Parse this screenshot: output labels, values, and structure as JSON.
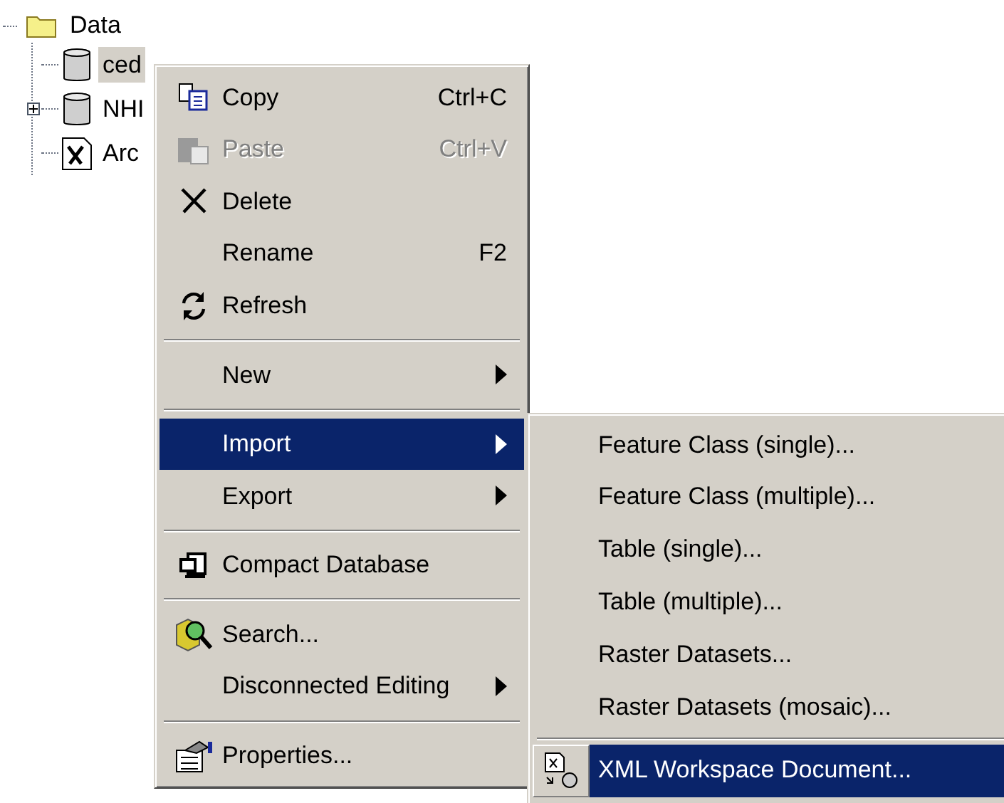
{
  "tree": {
    "label": "Data",
    "children": [
      {
        "label": "ced",
        "kind": "database",
        "collapsed": false,
        "selected": true
      },
      {
        "label": "NHI",
        "kind": "database",
        "collapsed": true,
        "selected": false
      },
      {
        "label": "Arc",
        "kind": "xml",
        "collapsed": false,
        "selected": false
      }
    ]
  },
  "context_menu": {
    "items": [
      {
        "kind": "item",
        "label": "Copy",
        "shortcut": "Ctrl+C",
        "disabled": false,
        "selected": false,
        "submenu": false
      },
      {
        "kind": "item",
        "label": "Paste",
        "shortcut": "Ctrl+V",
        "disabled": true,
        "selected": false,
        "submenu": false
      },
      {
        "kind": "item",
        "label": "Delete",
        "disabled": false,
        "selected": false,
        "submenu": false
      },
      {
        "kind": "item",
        "label": "Rename",
        "shortcut": "F2",
        "disabled": false,
        "selected": false,
        "submenu": false
      },
      {
        "kind": "item",
        "label": "Refresh",
        "disabled": false,
        "selected": false,
        "submenu": false
      },
      {
        "kind": "separator"
      },
      {
        "kind": "item",
        "label": "New",
        "disabled": false,
        "selected": false,
        "submenu": true
      },
      {
        "kind": "separator"
      },
      {
        "kind": "item",
        "label": "Import",
        "disabled": false,
        "selected": true,
        "submenu": true
      },
      {
        "kind": "item",
        "label": "Export",
        "disabled": false,
        "selected": false,
        "submenu": true
      },
      {
        "kind": "separator"
      },
      {
        "kind": "item",
        "label": "Compact Database",
        "disabled": false,
        "selected": false,
        "submenu": false
      },
      {
        "kind": "separator"
      },
      {
        "kind": "item",
        "label": "Search...",
        "disabled": false,
        "selected": false,
        "submenu": false
      },
      {
        "kind": "item",
        "label": "Disconnected Editing",
        "disabled": false,
        "selected": false,
        "submenu": true
      },
      {
        "kind": "separator"
      },
      {
        "kind": "item",
        "label": "Properties...",
        "disabled": false,
        "selected": false,
        "submenu": false
      }
    ]
  },
  "import_submenu": {
    "items": [
      {
        "kind": "item",
        "label": "Feature Class (single)...",
        "selected": false
      },
      {
        "kind": "item",
        "label": "Feature Class (multiple)...",
        "selected": false
      },
      {
        "kind": "item",
        "label": "Table (single)...",
        "selected": false
      },
      {
        "kind": "item",
        "label": "Table (multiple)...",
        "selected": false
      },
      {
        "kind": "item",
        "label": "Raster Datasets...",
        "selected": false
      },
      {
        "kind": "item",
        "label": "Raster Datasets (mosaic)...",
        "selected": false
      },
      {
        "kind": "separator"
      },
      {
        "kind": "item",
        "label": "XML Workspace Document...",
        "selected": true
      }
    ]
  }
}
